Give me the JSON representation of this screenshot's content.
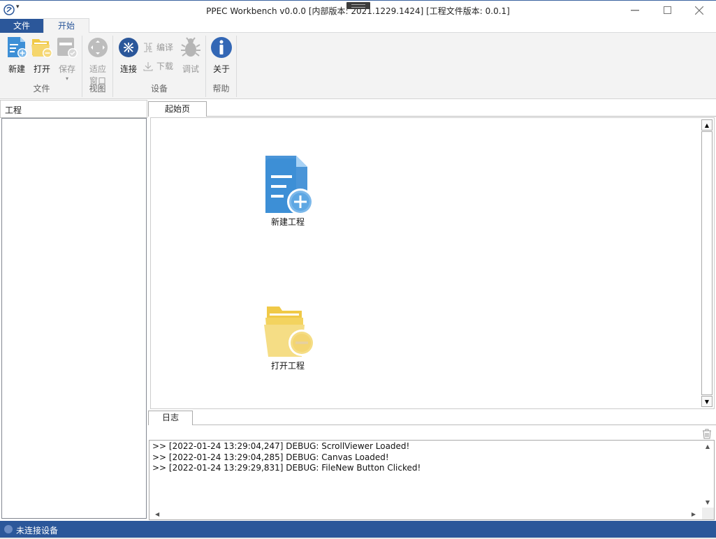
{
  "window": {
    "title": "PPEC Workbench v0.0.0 [内部版本: 2021.1229.1424] [工程文件版本: 0.0.1]",
    "controls": {
      "minimize": "—",
      "maximize": "☐",
      "close": "✕"
    }
  },
  "ribbon": {
    "tabs": [
      {
        "label": "文件",
        "active": false
      },
      {
        "label": "开始",
        "active": true
      }
    ],
    "groups": [
      {
        "label": "文件",
        "buttons": [
          {
            "label": "新建",
            "icon": "new-file-icon",
            "enabled": true
          },
          {
            "label": "打开",
            "icon": "open-folder-icon",
            "enabled": true
          },
          {
            "label": "保存",
            "icon": "save-icon",
            "enabled": false,
            "dropdown": "▾"
          }
        ]
      },
      {
        "label": "视图",
        "buttons": [
          {
            "label": "适应窗口",
            "label_line1": "适应",
            "label_line2": "窗口",
            "icon": "fit-window-icon",
            "enabled": false
          }
        ]
      },
      {
        "label": "设备",
        "buttons": [
          {
            "label": "连接",
            "icon": "connect-icon",
            "enabled": true
          },
          {
            "label": "编译",
            "icon": "compile-icon",
            "enabled": false
          },
          {
            "label": "下载",
            "icon": "download-icon",
            "enabled": false
          },
          {
            "label": "调试",
            "icon": "debug-bug-icon",
            "enabled": false
          }
        ]
      },
      {
        "label": "帮助",
        "buttons": [
          {
            "label": "关于",
            "icon": "info-icon",
            "enabled": true
          }
        ]
      }
    ]
  },
  "project_panel": {
    "title": "工程"
  },
  "document": {
    "tab": "起始页",
    "items": [
      {
        "label": "新建工程",
        "icon": "new-project-icon"
      },
      {
        "label": "打开工程",
        "icon": "open-project-icon"
      }
    ]
  },
  "log": {
    "tab": "日志",
    "lines": [
      ">> [2022-01-24 13:29:04,247] DEBUG: ScrollViewer Loaded!",
      ">> [2022-01-24 13:29:04,285] DEBUG: Canvas Loaded!",
      ">> [2022-01-24 13:29:29,831] DEBUG: FileNew Button Clicked!"
    ]
  },
  "status": {
    "text": "未连接设备"
  },
  "colors": {
    "accent": "#2b579a",
    "new_icon": "#3d8fd6",
    "open_icon": "#f2cf5b",
    "ribbon_bg": "#f3f3f3"
  }
}
